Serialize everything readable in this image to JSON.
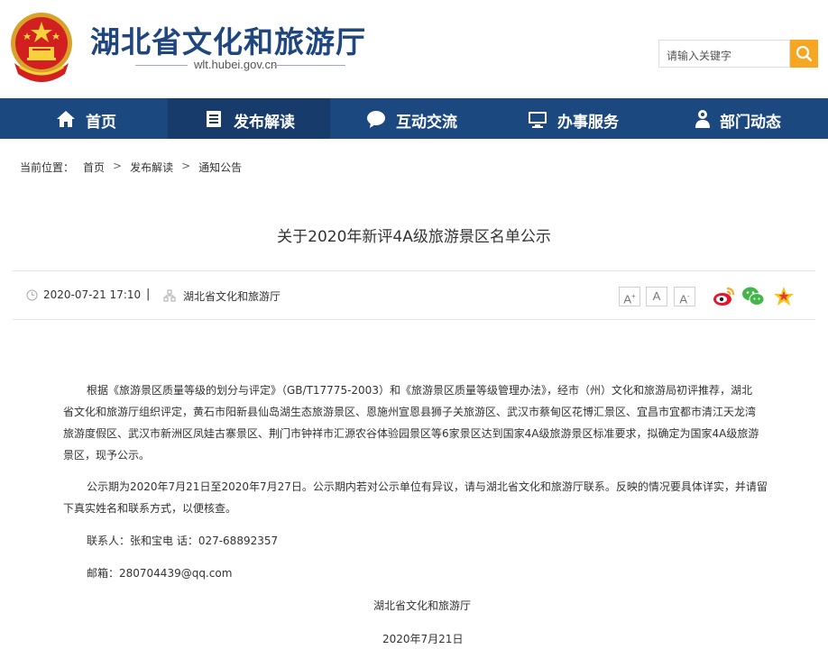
{
  "header": {
    "site_title": "湖北省文化和旅游厅",
    "site_domain": "wlt.hubei.gov.cn",
    "search_placeholder": "请输入关键字"
  },
  "nav": {
    "items": [
      {
        "label": "首页",
        "icon": "home-icon"
      },
      {
        "label": "发布解读",
        "icon": "document-icon",
        "active": true
      },
      {
        "label": "互动交流",
        "icon": "chat-icon"
      },
      {
        "label": "办事服务",
        "icon": "monitor-icon"
      },
      {
        "label": "部门动态",
        "icon": "person-icon"
      }
    ]
  },
  "breadcrumb": {
    "prefix": "当前位置：",
    "items": [
      "首页",
      "发布解读",
      "通知公告"
    ],
    "sep": ">"
  },
  "article": {
    "title": "关于2020年新评4A级旅游景区名单公示",
    "date": "2020-07-21 17:10",
    "pipe": "|",
    "source": "湖北省文化和旅游厅",
    "font_size_buttons": [
      "A+",
      "A",
      "A-"
    ],
    "share_icons": [
      "weibo-icon",
      "wechat-icon",
      "favorite-star-icon"
    ],
    "paragraphs": {
      "p1_line1": "根据《旅游景区质量等级的划分与评定》（GB/T17775-2003）和《旅游景区质量等级管理办法》，经市（州）文化和旅游局初评推荐，湖北",
      "p1_line2": "省文化和旅游厅组织评定，黄石市阳新县仙岛湖生态旅游景区、恩施州宣恩县狮子关旅游区、武汉市蔡甸区花博汇景区、宜昌市宜都市清江天龙湾",
      "p1_line3": "旅游度假区、武汉市新洲区凤娃古寨景区、荆门市钟祥市汇源农谷体验园景区等6家景区达到国家4A级旅游景区标准要求，拟确定为国家4A级旅游",
      "p1_line4": "景区，现予公示。",
      "p2_line1": "公示期为2020年7月21日至2020年7月27日。公示期内若对公示单位有异议，请与湖北省文化和旅游厅联系。反映的情况要具体详实，并请留",
      "p2_line2": "下真实姓名和联系方式，以便核查。",
      "contact": "联系人：张和宝电  话：027-68892357",
      "email": "邮箱：280704439@qq.com",
      "signature": "湖北省文化和旅游厅",
      "sign_date": "2020年7月21日"
    }
  },
  "colors": {
    "nav_bg": "#1c4880",
    "nav_active_bg": "#173b6b",
    "title_blue": "#20467f",
    "search_btn": "#f5a623"
  }
}
